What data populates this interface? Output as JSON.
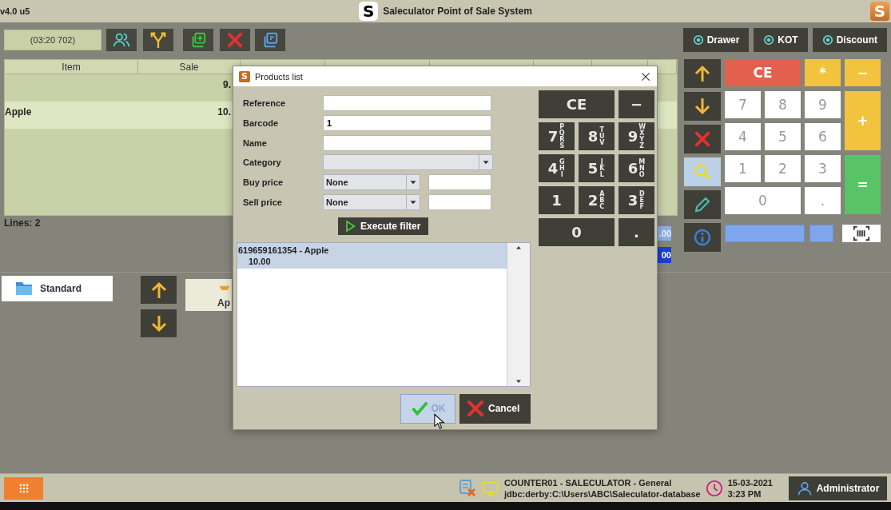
{
  "title_bar": {
    "version": "v4.0 u5",
    "logo": "S",
    "title": "Saleculator Point of Sale System",
    "corner_logo": "S"
  },
  "toolbar": {
    "ticket_id": "(03:20 702)",
    "tools": [
      {
        "kind": "customers"
      },
      {
        "kind": "split"
      },
      {
        "kind": "add"
      },
      {
        "kind": "delete"
      },
      {
        "kind": "copy"
      }
    ],
    "actions": [
      "Drawer",
      "KOT",
      "Discount"
    ]
  },
  "ticket": {
    "columns": [
      "Item",
      "Sale"
    ],
    "rows": [
      {
        "sale": "9.",
        "selected": false
      },
      {
        "item": "Apple",
        "sale": "10.",
        "selected": true
      }
    ],
    "lines": "Lines: 2",
    "totals": [
      {
        "text": ".00",
        "kind": "subtotal"
      },
      {
        "text": "00",
        "kind": "total"
      }
    ]
  },
  "side_buttons": [
    {
      "kind": "up",
      "selected": false
    },
    {
      "kind": "down",
      "selected": false
    },
    {
      "kind": "delete",
      "selected": false
    },
    {
      "kind": "search",
      "selected": true
    },
    {
      "kind": "edit",
      "selected": false
    },
    {
      "kind": "info",
      "selected": false
    }
  ],
  "keypad": [
    {
      "label": "CE",
      "kind": "clear"
    },
    {
      "label": "*",
      "kind": "op"
    },
    {
      "label": "−",
      "kind": "op"
    },
    {
      "label": "7",
      "kind": "digit"
    },
    {
      "label": "8",
      "kind": "digit"
    },
    {
      "label": "9",
      "kind": "digit"
    },
    {
      "label": "+",
      "kind": "tall-op"
    },
    {
      "label": "4",
      "kind": "digit"
    },
    {
      "label": "5",
      "kind": "digit"
    },
    {
      "label": "6",
      "kind": "digit"
    },
    {
      "label": "1",
      "kind": "digit"
    },
    {
      "label": "2",
      "kind": "digit"
    },
    {
      "label": "3",
      "kind": "digit"
    },
    {
      "label": "=",
      "kind": "equals"
    },
    {
      "label": "0",
      "kind": "wide-digit"
    },
    {
      "label": ".",
      "kind": "digit"
    }
  ],
  "categories": [
    {
      "label": "Standard"
    }
  ],
  "products": [
    {
      "label": "Ap"
    }
  ],
  "status_bar": {
    "connection": "COUNTER01 - SALECULATOR - General",
    "database": "jdbc:derby:C:\\Users\\ABC\\Saleculator-database",
    "date": "15-03-2021",
    "time": "3:23 PM",
    "user": "Administrator"
  },
  "dialog": {
    "icon": "S",
    "title": "Products list",
    "fields": [
      {
        "label": "Reference",
        "kind": "text"
      },
      {
        "label": "Barcode",
        "kind": "text",
        "value": "1"
      },
      {
        "label": "Name",
        "kind": "text"
      },
      {
        "label": "Category",
        "kind": "combo"
      },
      {
        "label": "Buy price",
        "kind": "price",
        "operator": "None"
      },
      {
        "label": "Sell price",
        "kind": "price",
        "operator": "None"
      }
    ],
    "filter_button": "Execute filter",
    "results": [
      {
        "name": "619659161354 - Apple",
        "price": "10.00",
        "selected": true
      }
    ],
    "keypad": [
      {
        "digit": "CE",
        "kind": "wide"
      },
      {
        "digit": "−",
        "kind": "key"
      },
      {
        "digit": "7",
        "letters": "PQRS",
        "kind": "key"
      },
      {
        "digit": "8",
        "letters": "TUV",
        "kind": "key"
      },
      {
        "digit": "9",
        "letters": "WXYZ",
        "kind": "key"
      },
      {
        "digit": "4",
        "letters": "GHI",
        "kind": "key"
      },
      {
        "digit": "5",
        "letters": "JKL",
        "kind": "key"
      },
      {
        "digit": "6",
        "letters": "MNO",
        "kind": "key"
      },
      {
        "digit": "1",
        "kind": "key"
      },
      {
        "digit": "2",
        "letters": "ABC",
        "kind": "key"
      },
      {
        "digit": "3",
        "letters": "DEF",
        "kind": "key"
      },
      {
        "digit": "0",
        "kind": "wide"
      },
      {
        "digit": ".",
        "kind": "key"
      }
    ],
    "buttons": [
      {
        "label": "OK",
        "kind": "ok",
        "hovered": true
      },
      {
        "label": "Cancel",
        "kind": "cancel",
        "hovered": false
      }
    ]
  }
}
